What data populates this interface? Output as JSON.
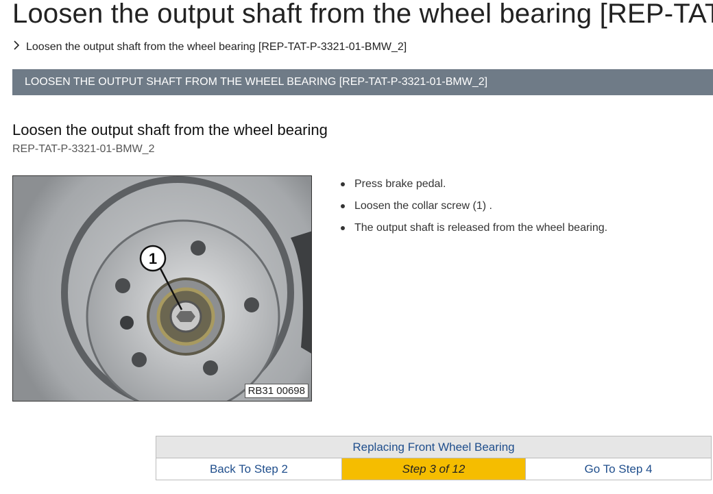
{
  "page": {
    "title": "Loosen the output shaft from the wheel bearing [REP-TAT-P",
    "breadcrumb_icon": "chevron-right-icon",
    "breadcrumb": "Loosen the output shaft from the wheel bearing [REP-TAT-P-3321-01-BMW_2]"
  },
  "section": {
    "bar_label": "LOOSEN THE OUTPUT SHAFT FROM THE WHEEL BEARING [REP-TAT-P-3321-01-BMW_2]",
    "heading": "Loosen the output shaft from the wheel bearing",
    "doc_id": "REP-TAT-P-3321-01-BMW_2"
  },
  "figure": {
    "callout": "1",
    "label": "RB31 00698"
  },
  "steps": [
    "Press brake pedal.",
    "Loosen the collar screw (1) .",
    "The output shaft is released from the wheel bearing."
  ],
  "navigation": {
    "title": "Replacing Front Wheel Bearing",
    "back": "Back To Step 2",
    "current": "Step 3 of 12",
    "next": "Go To Step 4"
  },
  "colors": {
    "section_bar": "#6f7b87",
    "current_step": "#f5bd00",
    "link": "#1f4e8c"
  }
}
